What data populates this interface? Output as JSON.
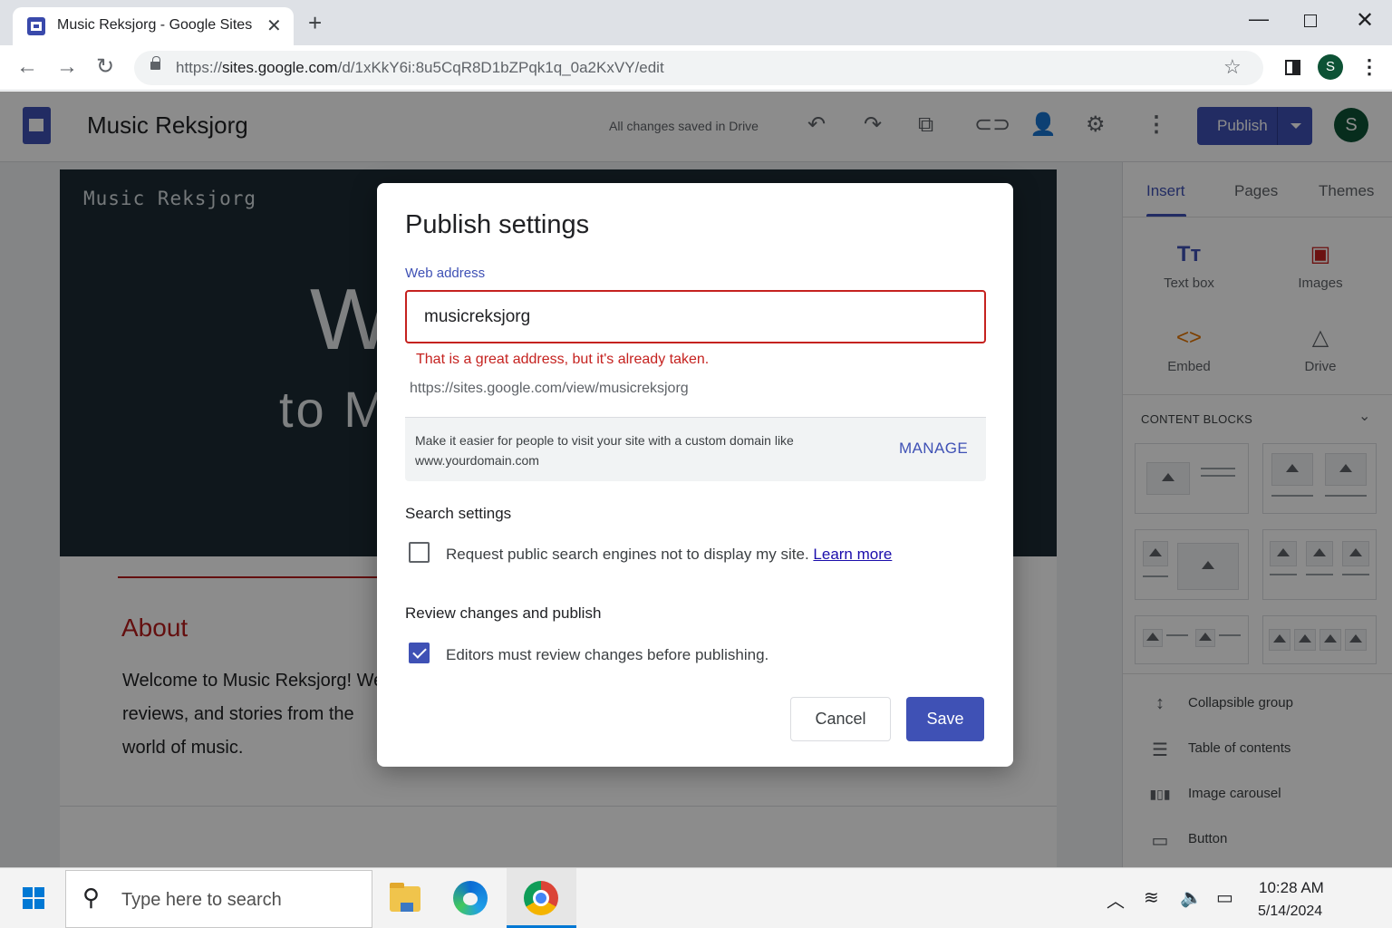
{
  "browser": {
    "tab_title": "Music Reksjorg - Google Sites",
    "tab_close": "✕",
    "new_tab": "+",
    "url_prefix": "https://",
    "url_domain": "sites.google.com",
    "url_path": "/d/1xKkY6i:8u5CqR8D1bZPqk1q_0a2KxVY/edit",
    "profile_initial": "S"
  },
  "app": {
    "site_name": "Music Reksjorg",
    "save_status": "All changes saved in Drive",
    "publish_label": "Publish",
    "avatar_initial": "S"
  },
  "site_page": {
    "header_name": "Music Reksjorg",
    "hero_line1": "W",
    "hero_line2": "to M",
    "about_title": "About",
    "about_text": "Welcome to Music Reksjorg! We reviews, and stories from the world of music."
  },
  "side_panel": {
    "tabs": [
      "Insert",
      "Pages",
      "Themes"
    ],
    "active_tab": "Insert",
    "insert_items": [
      {
        "label": "Text box",
        "icon": "Tт",
        "color": "#3f51b5"
      },
      {
        "label": "Images",
        "icon": "▣",
        "color": "#c5221f"
      },
      {
        "label": "Embed",
        "icon": "<>",
        "color": "#e37400"
      },
      {
        "label": "Drive",
        "icon": "△",
        "color": "#5f6368"
      }
    ],
    "content_blocks_title": "CONTENT BLOCKS",
    "tools": [
      {
        "label": "Collapsible group",
        "icon": "↕"
      },
      {
        "label": "Table of contents",
        "icon": "☰"
      },
      {
        "label": "Image carousel",
        "icon": "▮▯▮"
      },
      {
        "label": "Button",
        "icon": "▭"
      }
    ]
  },
  "dialog": {
    "title": "Publish settings",
    "web_address_label": "Web address",
    "web_address_value": "musicreksjorg",
    "error_text": "That is a great address, but it's already taken.",
    "preview_url": "https://sites.google.com/view/musicreksjorg",
    "domain_text": "Make it easier for people to visit your site with a custom domain like www.yourdomain.com",
    "manage_label": "MANAGE",
    "search_title": "Search settings",
    "search_checkbox_text": "Request public search engines not to display my site.",
    "search_checkbox_checked": false,
    "learn_more": "Learn more",
    "review_title": "Review changes and publish",
    "review_checkbox_text": "Editors must review changes before publishing.",
    "review_checkbox_checked": true,
    "cancel_label": "Cancel",
    "save_label": "Save",
    "accent_color": "#3f51b5",
    "error_color": "#c5221f"
  },
  "taskbar": {
    "search_placeholder": "Type here to search",
    "time": "10:28 AM",
    "date": "5/14/2024"
  }
}
